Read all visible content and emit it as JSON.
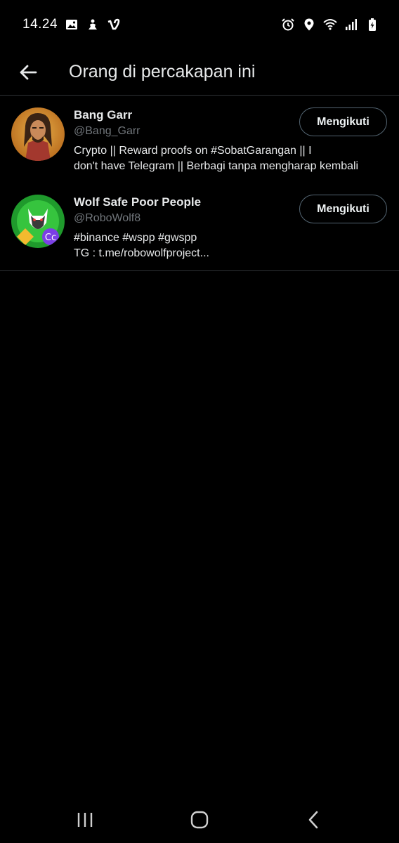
{
  "status_bar": {
    "time": "14.24",
    "left_icons": [
      "image-icon",
      "notification-icon",
      "vimeo-icon"
    ],
    "right_icons": [
      "alarm-icon",
      "location-icon",
      "wifi-icon",
      "signal-icon",
      "battery-charging-icon"
    ]
  },
  "header": {
    "back_icon": "arrow-left-icon",
    "title": "Orang di percakapan ini"
  },
  "users": [
    {
      "name": "Bang Garr",
      "handle": "@Bang_Garr",
      "bio_line1": "Crypto || Reward proofs on #SobatGarangan ||           I",
      "bio_line2": "don't have Telegram || Berbagi tanpa mengharap kembali",
      "follow_label": "Mengikuti"
    },
    {
      "name": "Wolf Safe Poor People",
      "handle": "@RoboWolf8",
      "bio_line1": "#binance #wspp #gwspp",
      "bio_line2": "TG : t.me/robowolfproject...",
      "follow_label": "Mengikuti"
    }
  ],
  "nav_bar": {
    "icons": [
      "recent-apps-icon",
      "home-icon",
      "back-icon"
    ]
  },
  "colors": {
    "background": "#000000",
    "divider": "#2f3336",
    "secondary_text": "#71767b",
    "button_border": "#536471"
  }
}
